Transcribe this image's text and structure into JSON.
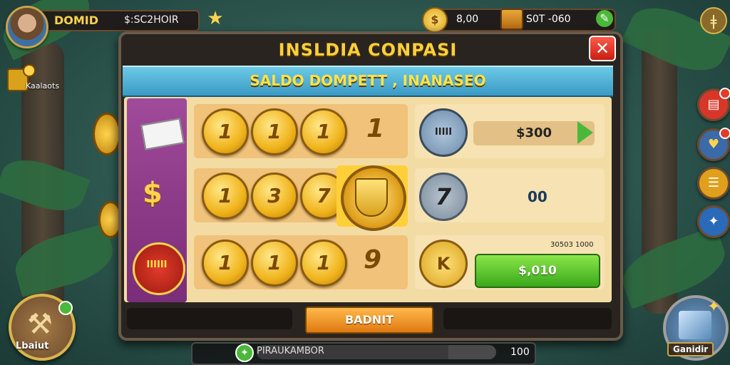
{
  "player": {
    "name": "DOMID",
    "money": "$:SC2HOIR"
  },
  "resources": {
    "coins": "8,00",
    "gems": "S0T -060"
  },
  "left_hud": {
    "label": "Kaalaots",
    "round_button_label": "Lbaiut"
  },
  "right_hud": {
    "big_button_label": "Ganidir"
  },
  "modal": {
    "title": "INSLDIA CONPASI",
    "banner": "SALDO DOMPETT , INANASEO",
    "sidebar_seal_label": "IIIIII",
    "rows": [
      {
        "coins": [
          "1",
          "1",
          "1"
        ],
        "trailing": "1"
      },
      {
        "coins": [
          "1",
          "3",
          "7"
        ],
        "trailing": ""
      },
      {
        "coins": [
          "1",
          "1",
          "1"
        ],
        "trailing": "9"
      }
    ],
    "right": {
      "token1_label": "IIIII",
      "price1": "$300",
      "token2_label": "7",
      "value2": "00",
      "small_label": "30503 1000",
      "token3_label": "K",
      "buy_label": "$,010"
    },
    "main_button": "BADNIT"
  },
  "statusbar": {
    "text": "PIRAUKAMBOR",
    "count": "100",
    "progress": 0.8
  },
  "icons": {
    "star": "star-icon",
    "coin": "coin-icon",
    "chest": "chest-icon",
    "plus": "plus-icon",
    "menu": "menu-icon",
    "close": "close-icon"
  },
  "colors": {
    "accent_gold": "#ffcf3a",
    "buy_green": "#3aa81a",
    "close_red": "#c81e12",
    "banner_blue": "#3a9ac4",
    "sidebar_purple": "#7a2d78"
  }
}
